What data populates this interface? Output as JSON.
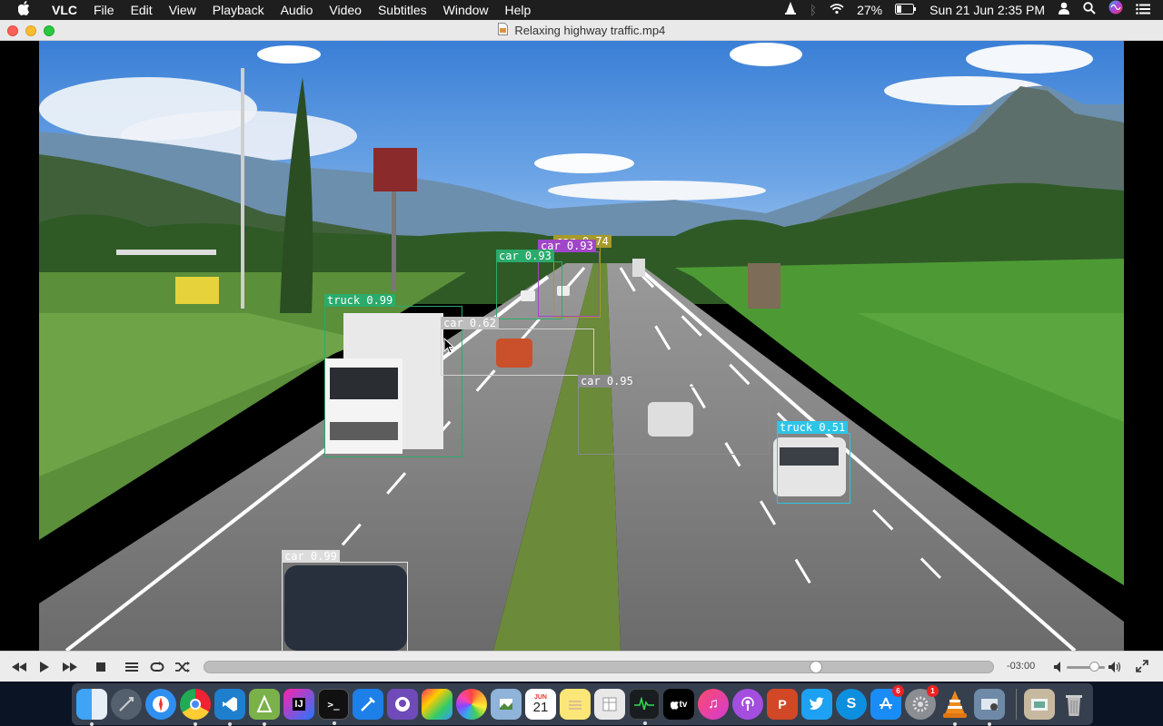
{
  "menubar": {
    "app": "VLC",
    "items": [
      "File",
      "Edit",
      "View",
      "Playback",
      "Audio",
      "Video",
      "Subtitles",
      "Window",
      "Help"
    ],
    "battery": "27%",
    "datetime": "Sun 21 Jun  2:35 PM"
  },
  "window": {
    "title": "Relaxing highway traffic.mp4"
  },
  "detections": [
    {
      "label": "car 0.74",
      "color": "#a89a2a"
    },
    {
      "label": "car 0.93",
      "color": "#a046c8"
    },
    {
      "label": "car 0.93",
      "color": "#2bab6c"
    },
    {
      "label": "truck 0.99",
      "color": "#2bab6c"
    },
    {
      "label": "car 0.62",
      "color": "#cfcfcf"
    },
    {
      "label": "car 0.95",
      "color": "#8a8a8a"
    },
    {
      "label": "truck 0.51",
      "color": "#2ec4e6"
    },
    {
      "label": "car 0.99",
      "color": "#e8e8e8"
    }
  ],
  "controls": {
    "time_remaining": "-03:00",
    "playback_progress": 0.78,
    "volume_level": 0.8
  },
  "dock": {
    "calendar_month": "JUN",
    "calendar_day": "21",
    "appstore_badge": "6",
    "settings_badge": "1"
  }
}
